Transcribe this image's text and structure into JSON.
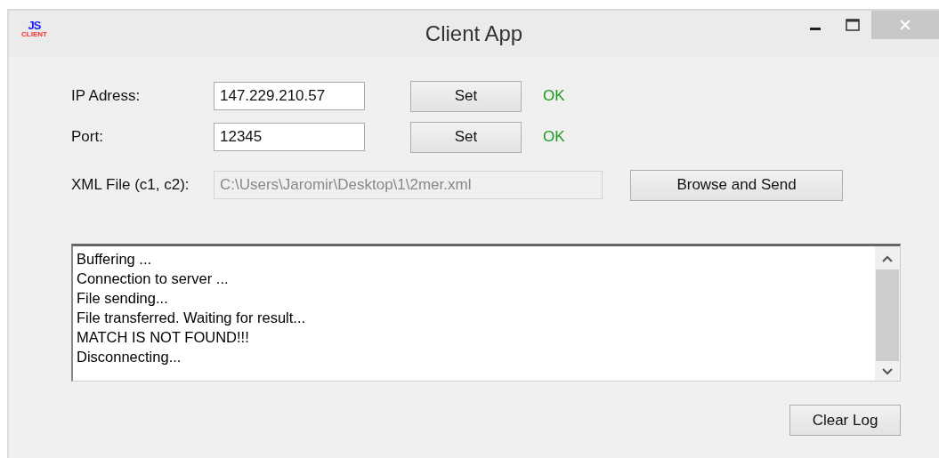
{
  "window": {
    "title": "Client App",
    "logo": {
      "mark": "JS",
      "caption": "CLIENT"
    }
  },
  "settings": [
    {
      "label": "IP Adress:",
      "value": "147.229.210.57",
      "button": "Set",
      "status": "OK"
    },
    {
      "label": "Port:",
      "value": "12345",
      "button": "Set",
      "status": "OK"
    }
  ],
  "xml_file": {
    "label": "XML File (c1, c2):",
    "value": "C:\\Users\\Jaromir\\Desktop\\1\\2mer.xml",
    "disabled": true,
    "button": "Browse and Send"
  },
  "log": [
    "Buffering ...",
    "Connection to server ...",
    "File sending...",
    "File transferred. Waiting for result...",
    "MATCH IS NOT FOUND!!!",
    "Disconnecting..."
  ],
  "clear_button": "Clear Log"
}
